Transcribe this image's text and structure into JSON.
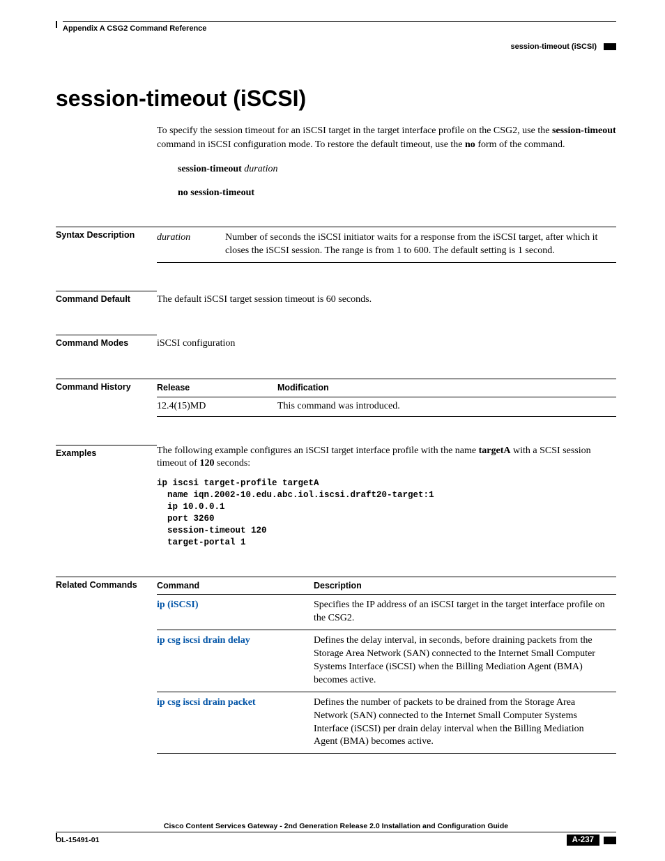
{
  "header": {
    "appendix": "Appendix A      CSG2 Command Reference",
    "topic": "session-timeout (iSCSI)"
  },
  "title": "session-timeout (iSCSI)",
  "intro": {
    "p1a": "To specify the session timeout for an iSCSI target in the target interface profile on the CSG2, use the ",
    "p1b": "session-timeout",
    "p1c": " command in iSCSI configuration mode. To restore the default timeout, use the ",
    "p1d": "no",
    "p1e": " form of the command.",
    "syntax1_cmd": "session-timeout ",
    "syntax1_arg": "duration",
    "syntax2": "no session-timeout"
  },
  "syntax": {
    "label": "Syntax Description",
    "arg": "duration",
    "desc": "Number of seconds the iSCSI initiator waits for a response from the iSCSI target, after which it closes the iSCSI session. The range is from 1 to 600. The default setting is 1 second."
  },
  "default": {
    "label": "Command Default",
    "text": "The default iSCSI target session timeout is 60 seconds."
  },
  "modes": {
    "label": "Command Modes",
    "text": "iSCSI configuration"
  },
  "history": {
    "label": "Command History",
    "col1": "Release",
    "col2": "Modification",
    "release": "12.4(15)MD",
    "mod": "This command was introduced."
  },
  "examples": {
    "label": "Examples",
    "p1a": "The following example configures an iSCSI target interface profile with the name ",
    "p1b": "targetA",
    "p1c": " with a SCSI session timeout of ",
    "p1d": "120",
    "p1e": " seconds:",
    "code": "ip iscsi target-profile targetA\n  name iqn.2002-10.edu.abc.iol.iscsi.draft20-target:1\n  ip 10.0.0.1\n  port 3260\n  session-timeout 120\n  target-portal 1"
  },
  "related": {
    "label": "Related Commands",
    "col1": "Command",
    "col2": "Description",
    "rows": [
      {
        "cmd": "ip (iSCSI)",
        "desc": "Specifies the IP address of an iSCSI target in the target interface profile on the CSG2."
      },
      {
        "cmd": "ip csg iscsi drain delay",
        "desc": "Defines the delay interval, in seconds, before draining packets from the Storage Area Network (SAN) connected to the Internet Small Computer Systems Interface (iSCSI) when the Billing Mediation Agent (BMA) becomes active."
      },
      {
        "cmd": "ip csg iscsi drain packet",
        "desc": "Defines the number of packets to be drained from the Storage Area Network (SAN) connected to the Internet Small Computer Systems Interface (iSCSI) per drain delay interval when the Billing Mediation Agent (BMA) becomes active."
      }
    ]
  },
  "footer": {
    "guide": "Cisco Content Services Gateway - 2nd Generation Release 2.0 Installation and Configuration Guide",
    "docid": "OL-15491-01",
    "page": "A-237"
  }
}
